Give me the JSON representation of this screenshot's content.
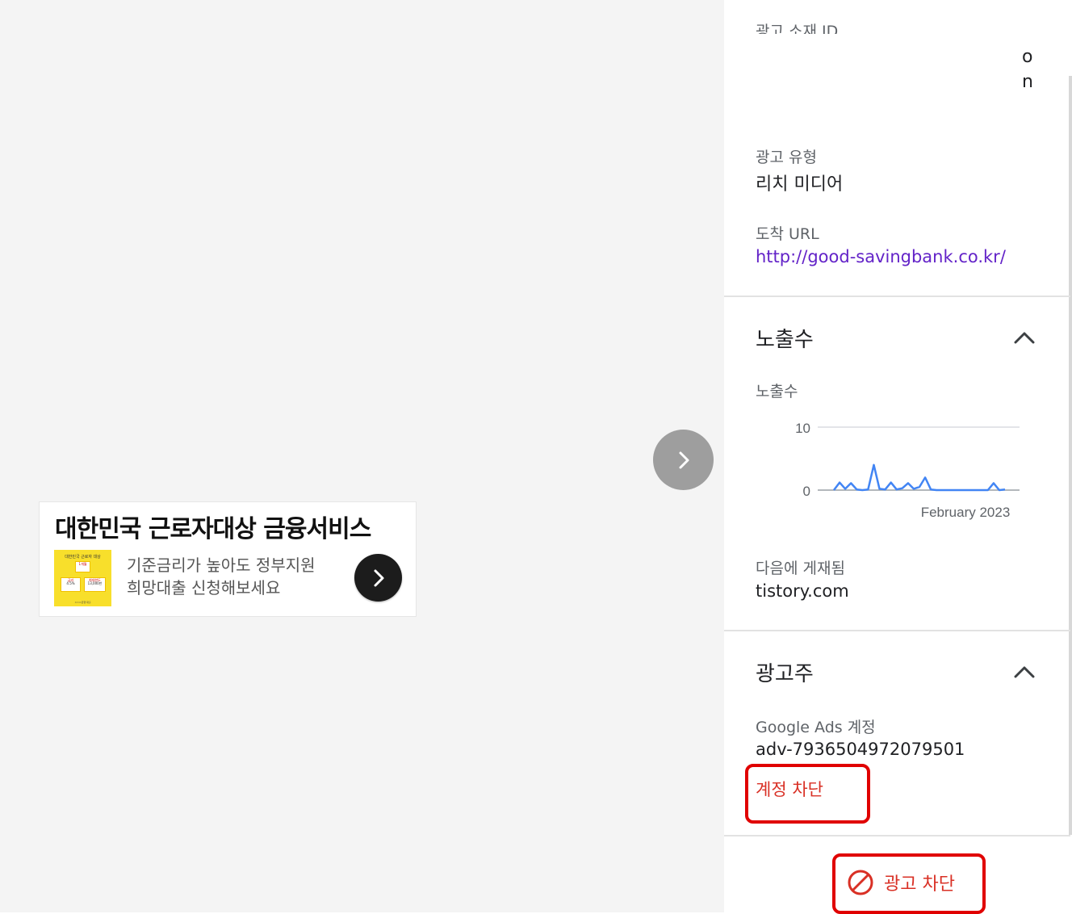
{
  "ad_preview": {
    "headline": "대한민국 근로자대상 금융서비스",
    "description_line1": "기준금리가 높아도 정부지원",
    "description_line2": "희망대출 신청해보세요",
    "thumbnail": {
      "title": "대한민국 근로자 대상",
      "badge": "1개월",
      "rate_label": "금리",
      "rate": "4.5%",
      "limit_label": "최대한도",
      "limit": "13,000만",
      "footer": "ㅇㅇㅇ은행 대출"
    },
    "accent_color": "#f8df2b"
  },
  "details": {
    "creative_id_label": "광고 소재 ID",
    "creative_id_value_end_line1": "o",
    "creative_id_value_end_line2": "n",
    "ad_type_label": "광고 유형",
    "ad_type_value": "리치 미디어",
    "landing_url_label": "도착 URL",
    "landing_url_value": "http://good-savingbank.co.kr/"
  },
  "impressions": {
    "section_title": "노출수",
    "chart_label": "노출수",
    "published_on_label": "다음에 게재됨",
    "published_on_value": "tistory.com"
  },
  "advertiser": {
    "section_title": "광고주",
    "account_label": "Google Ads 계정",
    "account_value": "adv-7936504972079501",
    "block_account_label": "계정 차단"
  },
  "footer": {
    "block_ad_label": "광고 차단",
    "block_icon": "block-icon"
  },
  "chart_data": {
    "type": "line",
    "y_ticks": [
      "10",
      "0"
    ],
    "ylim": [
      0,
      10
    ],
    "x_tick_label": "February 2023",
    "series": [
      {
        "color": "#4285f4",
        "values": [
          0,
          1.2,
          0.2,
          1.1,
          0.1,
          0,
          0.1,
          4,
          0.2,
          0.1,
          1.2,
          0.1,
          0.3,
          1.1,
          0.2,
          0.5,
          2,
          0.1,
          0,
          0,
          0,
          0,
          0,
          0,
          0,
          0,
          0,
          0,
          1.1,
          0,
          0.1
        ]
      }
    ]
  }
}
